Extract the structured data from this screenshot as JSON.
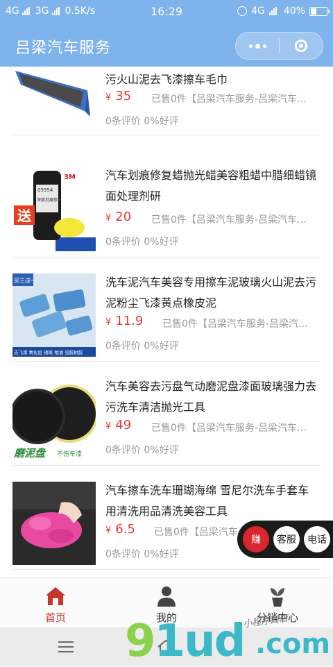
{
  "status_bar": {
    "net1": "4G",
    "net2": "3G",
    "speed": "0.5K/s",
    "time": "16:29",
    "net3": "4G",
    "battery": "40%"
  },
  "header": {
    "title": "吕梁汽车服务"
  },
  "products": [
    {
      "title": "汽车美容保养磨泥毛巾粘土布魔泥布洗车去污火山泥去飞漆擦车毛巾",
      "currency": "¥",
      "price": "35",
      "sold": "已售0件【吕梁汽车服务-吕梁汽车…",
      "reviews": "0条评价 0%好评"
    },
    {
      "title": "汽车划痕修复蜡抛光蜡美容粗蜡中腊细蜡镜面处理剂研",
      "currency": "¥",
      "price": "20",
      "sold": "已售0件【吕梁汽车服务-吕梁汽车…",
      "reviews": "0条评价 0%好评",
      "image_text": {
        "brand": "3M",
        "code": "05954",
        "label": "深度划痕修复",
        "stamp": "送"
      }
    },
    {
      "title": "洗车泥汽车美容专用擦车泥玻璃火山泥去污泥粉尘飞漆黄点橡皮泥",
      "currency": "¥",
      "price": "11.9",
      "sold": "已售0件【吕梁汽车服务-吕梁汽…",
      "reviews": "0条评价 0%好评",
      "image_text": {
        "tag": "买三送一",
        "caption": "去飞漆 氧化层 锈斑 柏油 虫胶树胶"
      }
    },
    {
      "title": "汽车美容去污盘气动磨泥盘漆面玻璃强力去污洗车清洁抛光工具",
      "currency": "¥",
      "price": "49",
      "sold": "已售0件【吕梁汽车服务-吕梁汽车…",
      "reviews": "0条评价 0%好评",
      "image_text": {
        "label": "磨泥盘",
        "sub": "不伤车漆"
      }
    },
    {
      "title": "汽车擦车洗车珊瑚海绵 雪尼尔洗车手套车用清洗用品清洗美容工具",
      "currency": "¥",
      "price": "6.5",
      "sold": "已售0件【吕梁汽车",
      "reviews": "0条评价 0%好评"
    }
  ],
  "float_buttons": {
    "earn": "赚",
    "service": "客服",
    "phone": "电话"
  },
  "tabs": [
    {
      "label": "首页",
      "icon": "home-icon"
    },
    {
      "label": "我的",
      "icon": "person-icon"
    },
    {
      "label": "分销中心",
      "icon": "plant-icon"
    }
  ],
  "watermark": {
    "logo_g": "9",
    "logo_rest": "1ud",
    "logo_tld": ".com",
    "script": "小程序商店"
  },
  "colors": {
    "header": "#7fb3ec",
    "price": "#e23b3b",
    "active_tab": "#c8342e"
  }
}
